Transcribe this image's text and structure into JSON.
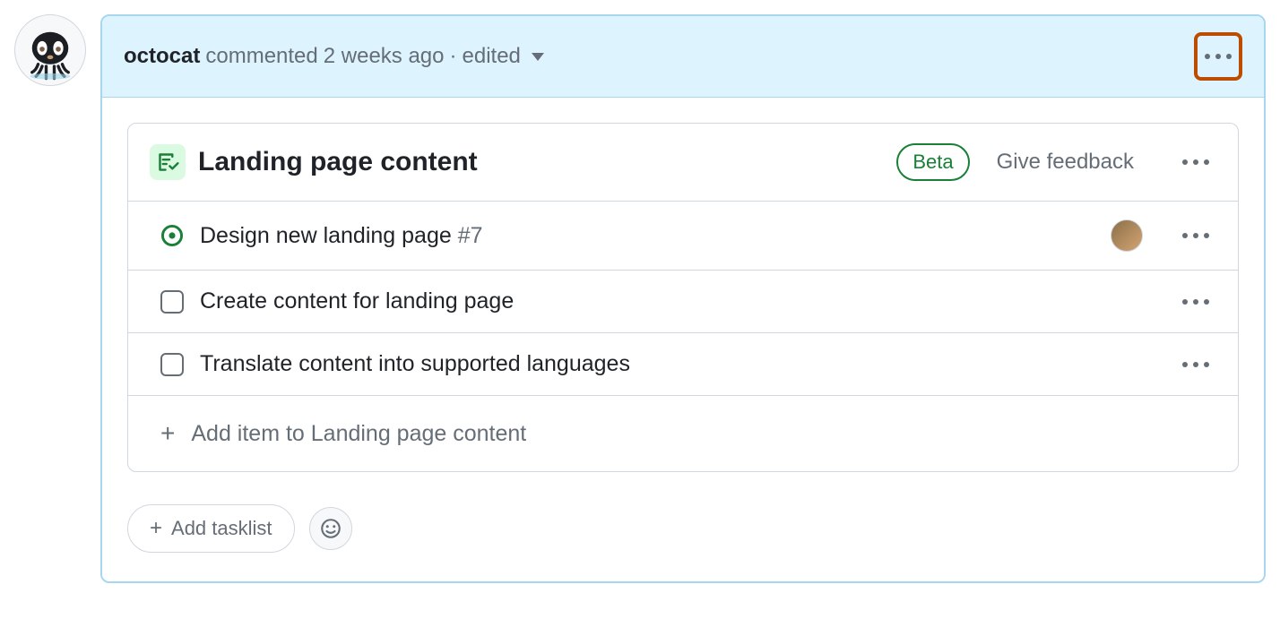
{
  "comment": {
    "author": "octocat",
    "action": "commented",
    "timestamp": "2 weeks ago",
    "separator": "·",
    "edited_label": "edited"
  },
  "tasklist": {
    "title": "Landing page content",
    "beta_label": "Beta",
    "feedback_label": "Give feedback",
    "items": [
      {
        "type": "issue",
        "label": "Design new landing page",
        "ref": "#7",
        "has_assignee": true
      },
      {
        "type": "checkbox",
        "label": "Create content for landing page",
        "ref": "",
        "has_assignee": false
      },
      {
        "type": "checkbox",
        "label": "Translate content into supported languages",
        "ref": "",
        "has_assignee": false
      }
    ],
    "add_item_label": "Add item to Landing page content"
  },
  "footer": {
    "add_tasklist_label": "Add tasklist"
  }
}
